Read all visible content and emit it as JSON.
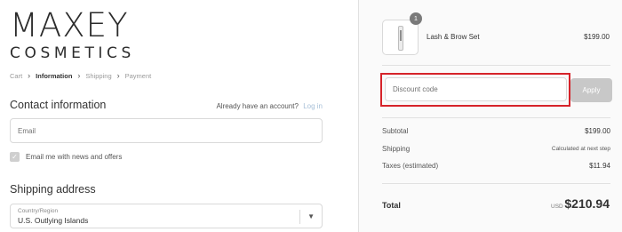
{
  "brand": {
    "name": "MAXEY",
    "subname": "COSMETICS"
  },
  "breadcrumb": [
    "Cart",
    "Information",
    "Shipping",
    "Payment"
  ],
  "contact": {
    "title": "Contact information",
    "login_prompt": "Already have an account?",
    "login_link": "Log in",
    "email_placeholder": "Email",
    "newsletter_label": "Email me with news and offers",
    "newsletter_checked": true
  },
  "shipping": {
    "title": "Shipping address",
    "country_label": "Country/Region",
    "country_value": "U.S. Outlying Islands"
  },
  "product": {
    "name": "Lash & Brow Set",
    "price": "$199.00",
    "quantity": "1"
  },
  "discount": {
    "placeholder": "Discount code",
    "apply_label": "Apply"
  },
  "summary": {
    "subtotal_label": "Subtotal",
    "subtotal_value": "$199.00",
    "shipping_label": "Shipping",
    "shipping_value": "Calculated at next step",
    "taxes_label": "Taxes (estimated)",
    "taxes_value": "$11.94",
    "total_label": "Total",
    "currency": "USD",
    "total_value": "$210.94"
  },
  "colors": {
    "highlight": "#d6232a",
    "link": "#a7c0d8",
    "button_disabled": "#c8c8c8"
  },
  "icons": {
    "breadcrumb_sep": "chevron-right-icon",
    "select_caret": "caret-down-icon",
    "checkbox": "check-icon"
  }
}
